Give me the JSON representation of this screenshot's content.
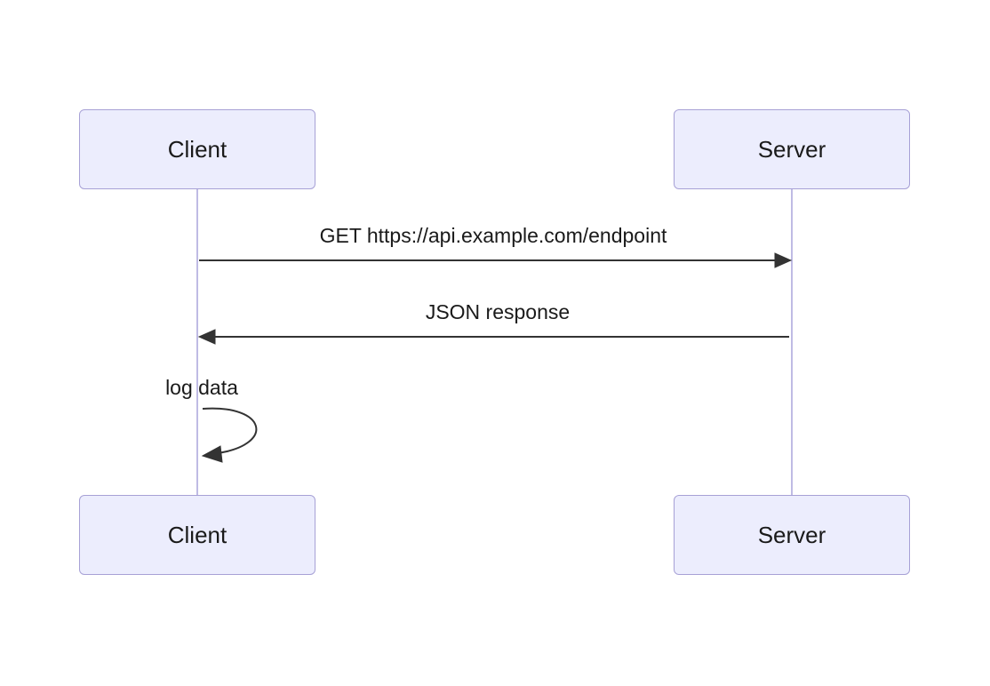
{
  "diagram": {
    "type": "sequence",
    "actors": [
      {
        "name": "Client"
      },
      {
        "name": "Server"
      }
    ],
    "messages": [
      {
        "from": "Client",
        "to": "Server",
        "label": "GET https://api.example.com/endpoint"
      },
      {
        "from": "Server",
        "to": "Client",
        "label": "JSON response"
      },
      {
        "from": "Client",
        "to": "Client",
        "label": "log data",
        "self": true
      }
    ],
    "colors": {
      "actor_fill": "#ecedfd",
      "actor_border": "#a7a1d6",
      "lifeline": "#bfbbe4",
      "arrow": "#333333"
    }
  }
}
